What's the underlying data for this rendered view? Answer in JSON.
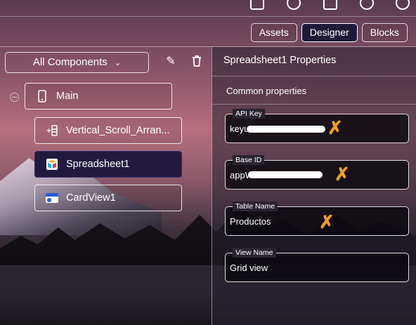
{
  "header": {
    "icons": [
      "window-icon",
      "gallery-icon",
      "copy-icon",
      "settings-icon",
      "profile-icon"
    ]
  },
  "view_switcher": {
    "assets_label": "Assets",
    "designer_label": "Designer",
    "blocks_label": "Blocks",
    "active": "Designer"
  },
  "components": {
    "filter_label": "All Components",
    "tree": [
      {
        "label": "Main",
        "icon": "phone-icon",
        "selected": false
      },
      {
        "label": "Vertical_Scroll_Arran...",
        "icon": "vertical-scroll-icon",
        "selected": false
      },
      {
        "label": "Spreadsheet1",
        "icon": "spreadsheet-icon",
        "selected": true
      },
      {
        "label": "CardView1",
        "icon": "cardview-icon",
        "selected": false
      }
    ]
  },
  "properties": {
    "title": "Spreadsheet1 Properties",
    "section": "Common properties",
    "fields": [
      {
        "label": "API Key",
        "value": "keyu"
      },
      {
        "label": "Base ID",
        "value": "appW"
      },
      {
        "label": "Table Name",
        "value": "Productos"
      },
      {
        "label": "View Name",
        "value": "Grid view"
      }
    ]
  },
  "colors": {
    "selected_bg": "#221a3e",
    "annotation": "#f0a020"
  }
}
